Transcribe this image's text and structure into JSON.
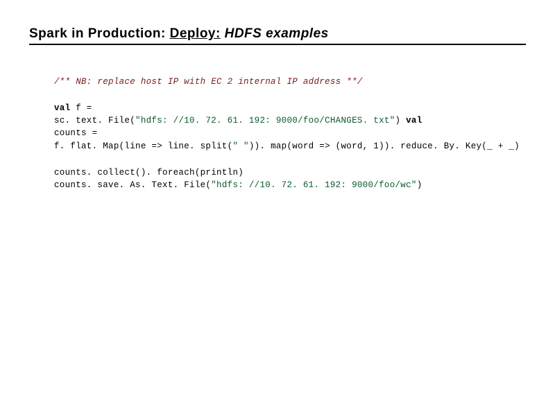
{
  "title": {
    "part1": "Spark in Production:",
    "part2": "Deploy:",
    "part3": "HDFS examples"
  },
  "code": {
    "comment": "/** NB: replace host IP with EC 2 internal IP address **/",
    "line1_kw": "val",
    "line1_rest": " f =",
    "line2_a": "sc. text. File(",
    "line2_str": "\"hdfs: //10. 72. 61. 192: 9000/foo/CHANGES. txt\"",
    "line2_b": ") ",
    "line2_kw": "val",
    "line3": "counts =",
    "line4_a": " f. flat. Map(line => line. split(",
    "line4_str": "\" \"",
    "line4_b": ")). map(word => (word, 1)). reduce. By. Key(_ + _)",
    "line5": "counts. collect(). foreach(println)",
    "line6_a": "counts. save. As. Text. File(",
    "line6_str": "\"hdfs: //10. 72. 61. 192: 9000/foo/wc\"",
    "line6_b": ")"
  }
}
